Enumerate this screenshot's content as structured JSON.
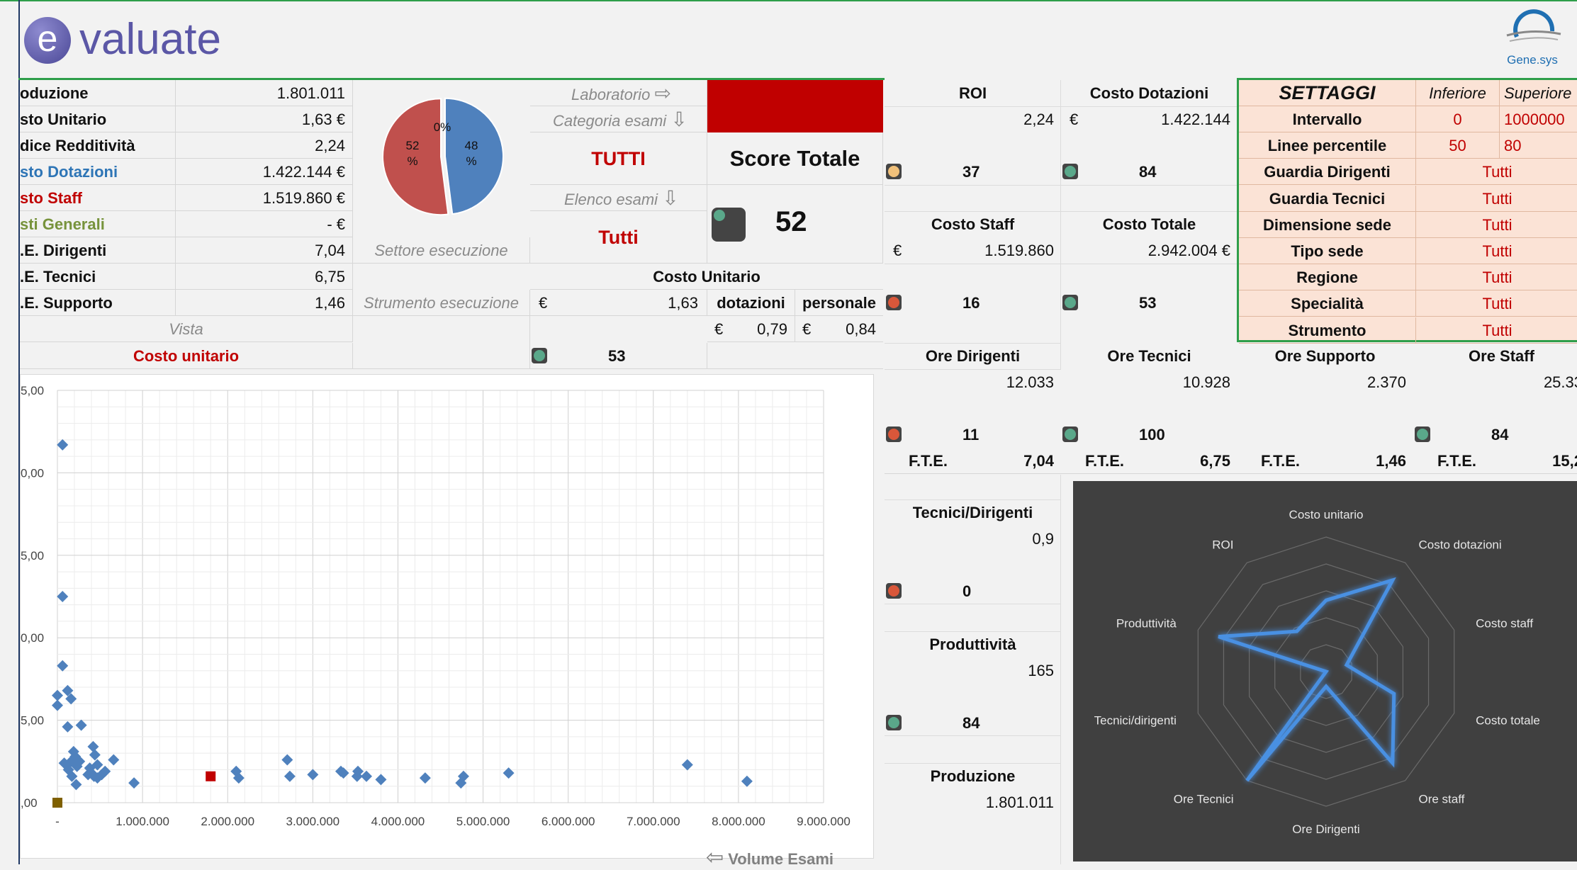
{
  "brand": {
    "logo_letter": "e",
    "logo_text": "valuate",
    "partner": "Gene.sys"
  },
  "summary": [
    {
      "label": "oduzione",
      "value": "1.801.011",
      "color": "#111111"
    },
    {
      "label": "sto Unitario",
      "value": "1,63 €",
      "color": "#111111"
    },
    {
      "label": "dice Redditività",
      "value": "2,24",
      "color": "#111111"
    },
    {
      "label": "sto Dotazioni",
      "value": "1.422.144 €",
      "color": "#2e75b6"
    },
    {
      "label": "sto Staff",
      "value": "1.519.860 €",
      "color": "#c00000"
    },
    {
      "label": "sti Generali",
      "value": "-   €",
      "color": "#77933c"
    },
    {
      "label": ".E. Dirigenti",
      "value": "7,04",
      "color": "#111111"
    },
    {
      "label": ".E. Tecnici",
      "value": "6,75",
      "color": "#111111"
    },
    {
      "label": ".E. Supporto",
      "value": "1,46",
      "color": "#111111"
    }
  ],
  "vista": {
    "label": "Vista",
    "value": "Costo unitario"
  },
  "pie": {
    "slices": [
      {
        "label": "48 %",
        "value": 48,
        "color": "#4f81bd"
      },
      {
        "label": "52 %",
        "value": 52,
        "color": "#c0504d"
      },
      {
        "label": "0%",
        "value": 0,
        "color": "#9bbb59"
      }
    ]
  },
  "settore": "Settore esecuzione",
  "strumento": "Strumento esecuzione",
  "filters": {
    "laboratorio_label": "Laboratorio",
    "categoria_label": "Categoria esami",
    "categoria_value": "TUTTI",
    "elenco_label": "Elenco esami",
    "elenco_value": "Tutti"
  },
  "score": {
    "label": "Score Totale",
    "value": "52"
  },
  "costo_unitario": {
    "title": "Costo Unitario",
    "value": "1,63",
    "currency": "€",
    "dotazioni_label": "dotazioni",
    "personale_label": "personale",
    "dotazioni_value": "0,79",
    "personale_value": "0,84",
    "score": "53"
  },
  "metrics": {
    "roi": {
      "title": "ROI",
      "value": "2,24",
      "score": "37"
    },
    "costo_dotazioni": {
      "title": "Costo Dotazioni",
      "currency": "€",
      "value": "1.422.144",
      "score": "84"
    },
    "costo_staff": {
      "title": "Costo Staff",
      "currency": "€",
      "value": "1.519.860",
      "score": "16"
    },
    "costo_totale": {
      "title": "Costo Totale",
      "value": "2.942.004 €",
      "score": "53"
    },
    "ore_dirigenti": {
      "title": "Ore Dirigenti",
      "value": "12.033",
      "score": "11",
      "fte_label": "F.T.E.",
      "fte": "7,04"
    },
    "ore_tecnici": {
      "title": "Ore Tecnici",
      "value": "10.928",
      "score": "100",
      "fte_label": "F.T.E.",
      "fte": "6,75"
    },
    "ore_supporto": {
      "title": "Ore Supporto",
      "value": "2.370",
      "fte_label": "F.T.E.",
      "fte": "1,46"
    },
    "ore_staff": {
      "title": "Ore Staff",
      "value": "25.33",
      "score": "84",
      "fte_label": "F.T.E.",
      "fte": "15,2"
    },
    "tecnici_dirigenti": {
      "title": "Tecnici/Dirigenti",
      "value": "0,9",
      "score": "0"
    },
    "produttivita": {
      "title": "Produttività",
      "value": "165",
      "score": "84"
    },
    "produzione": {
      "title": "Produzione",
      "value": "1.801.011"
    }
  },
  "settings": {
    "title": "SETTAGGI",
    "col_inf": "Inferiore",
    "col_sup": "Superiore",
    "rows": [
      {
        "label": "Intervallo",
        "inf": "0",
        "sup": "1000000"
      },
      {
        "label": "Linee percentile",
        "inf": "50",
        "sup": "80"
      },
      {
        "label": "Guardia Dirigenti",
        "all": "Tutti"
      },
      {
        "label": "Guardia Tecnici",
        "all": "Tutti"
      },
      {
        "label": "Dimensione sede",
        "all": "Tutti"
      },
      {
        "label": "Tipo sede",
        "all": "Tutti"
      },
      {
        "label": "Regione",
        "all": "Tutti"
      },
      {
        "label": "Specialità",
        "all": "Tutti"
      },
      {
        "label": "Strumento",
        "all": "Tutti"
      }
    ]
  },
  "light_colors": {
    "orange": "#f0c07a",
    "green": "#5aa88a",
    "red": "#d9573a"
  },
  "scatter_axis_label": "Volume Esami",
  "chart_data": [
    {
      "type": "scatter",
      "title": "",
      "xlabel": "Volume Esami",
      "ylabel": "",
      "xlim": [
        0,
        9000000
      ],
      "ylim": [
        0,
        25
      ],
      "xticks": [
        "-",
        "1.000.000",
        "2.000.000",
        "3.000.000",
        "4.000.000",
        "5.000.000",
        "6.000.000",
        "7.000.000",
        "8.000.000",
        "9.000.000"
      ],
      "yticks": [
        ",00",
        "5,00",
        "0,00",
        "5,00",
        "0,00",
        "5,00"
      ],
      "grid": true,
      "series": [
        {
          "color": "#4f81bd",
          "points": [
            [
              60000,
              21.7
            ],
            [
              60000,
              12.5
            ],
            [
              60000,
              8.3
            ],
            [
              0,
              6.5
            ],
            [
              0,
              5.9
            ],
            [
              120000,
              6.8
            ],
            [
              160000,
              6.3
            ],
            [
              280000,
              4.7
            ],
            [
              120000,
              4.6
            ],
            [
              80000,
              2.4
            ],
            [
              160000,
              2.5
            ],
            [
              190000,
              3.1
            ],
            [
              210000,
              2.8
            ],
            [
              230000,
              2.2
            ],
            [
              260000,
              2.5
            ],
            [
              130000,
              2.0
            ],
            [
              170000,
              1.6
            ],
            [
              220000,
              1.1
            ],
            [
              360000,
              1.7
            ],
            [
              380000,
              2.1
            ],
            [
              420000,
              3.4
            ],
            [
              440000,
              2.9
            ],
            [
              470000,
              2.3
            ],
            [
              400000,
              1.8
            ],
            [
              430000,
              1.6
            ],
            [
              470000,
              1.5
            ],
            [
              520000,
              1.7
            ],
            [
              560000,
              1.9
            ],
            [
              660000,
              2.6
            ],
            [
              900000,
              1.2
            ],
            [
              2100000,
              1.9
            ],
            [
              2130000,
              1.5
            ],
            [
              2700000,
              2.6
            ],
            [
              2730000,
              1.6
            ],
            [
              3000000,
              1.7
            ],
            [
              3330000,
              1.9
            ],
            [
              3360000,
              1.8
            ],
            [
              3520000,
              1.6
            ],
            [
              3530000,
              1.9
            ],
            [
              3630000,
              1.6
            ],
            [
              3800000,
              1.4
            ],
            [
              4320000,
              1.5
            ],
            [
              4740000,
              1.2
            ],
            [
              4770000,
              1.6
            ],
            [
              5300000,
              1.8
            ],
            [
              7400000,
              2.3
            ],
            [
              8100000,
              1.3
            ]
          ]
        },
        {
          "color": "#c00000",
          "points": [
            [
              1800000,
              1.6
            ]
          ]
        },
        {
          "color": "#7f6000",
          "points": [
            [
              0,
              0
            ]
          ]
        }
      ]
    },
    {
      "type": "radar",
      "title": "",
      "axes": [
        "Costo unitario",
        "Costo dotazioni",
        "Costo staff",
        "Costo totale",
        "Ore staff",
        "Ore Dirigenti",
        "Ore Tecnici",
        "Tecnici/dirigenti",
        "Produttività",
        "ROI"
      ],
      "range": [
        0,
        100
      ],
      "series": [
        {
          "values": [
            53,
            84,
            16,
            53,
            84,
            11,
            100,
            0,
            84,
            37
          ]
        }
      ]
    }
  ]
}
